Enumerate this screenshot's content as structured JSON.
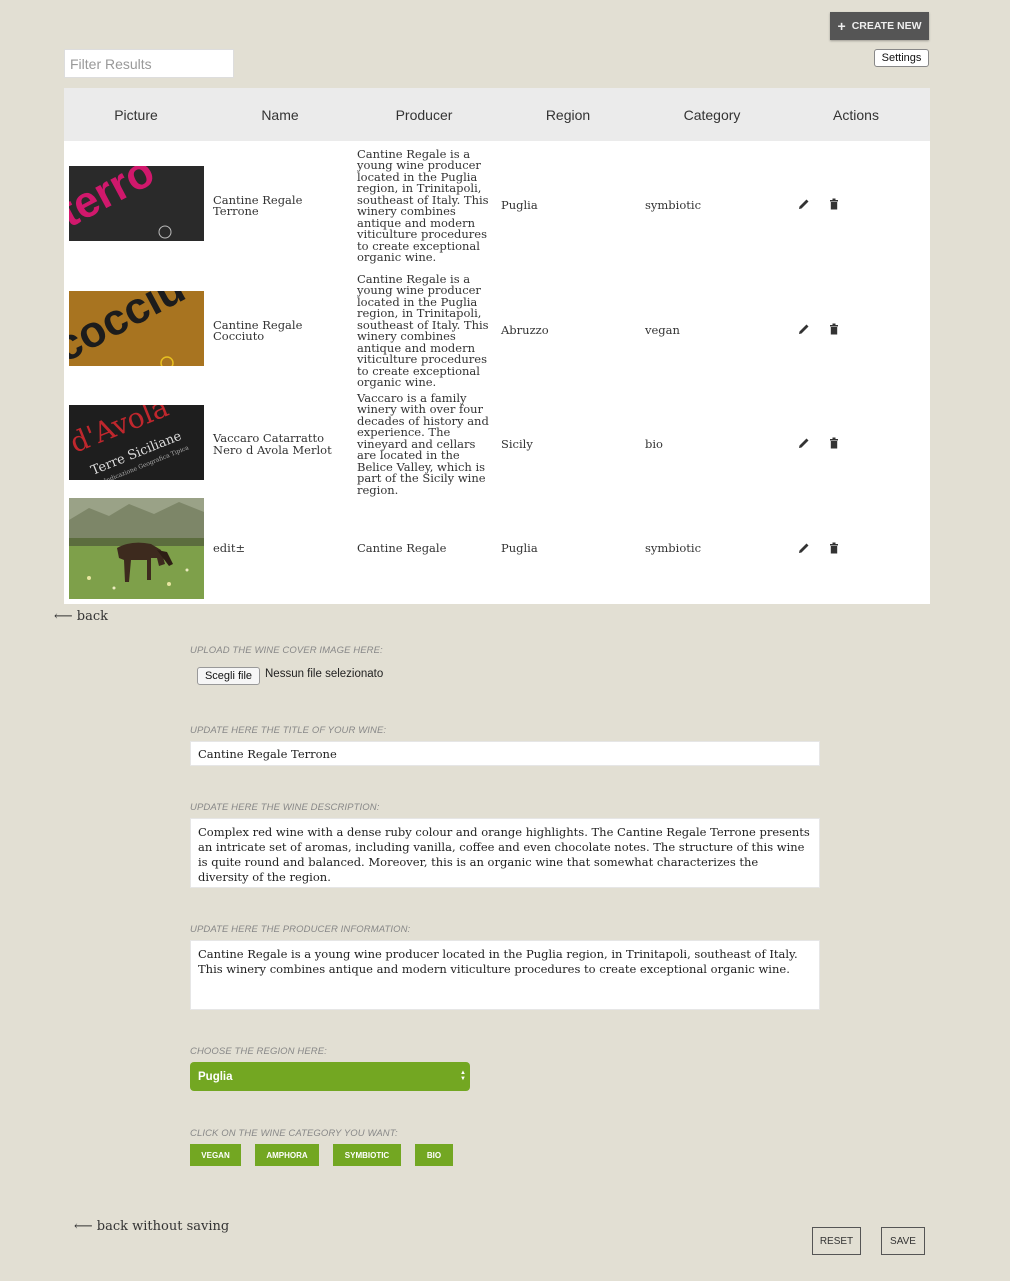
{
  "toolbar": {
    "create_label": "CREATE NEW",
    "filter_placeholder": "Filter Results",
    "settings_label": "Settings"
  },
  "table": {
    "columns": [
      "Picture",
      "Name",
      "Producer",
      "Region",
      "Category",
      "Actions"
    ],
    "rows": [
      {
        "name": "Cantine Regale Terrone",
        "producer": "Cantine Regale is a young wine producer located in the Puglia region, in Trinitapoli, southeast of Italy. This winery combines antique and modern viticulture procedures to create exceptional organic wine.",
        "region": "Puglia",
        "category": "symbiotic",
        "picture_text": "terro"
      },
      {
        "name": "Cantine Regale Cocciuto",
        "producer": "Cantine Regale is a young wine producer located in the Puglia region, in Trinitapoli, southeast of Italy. This winery combines antique and modern viticulture procedures to create exceptional organic wine.",
        "region": "Abruzzo",
        "category": "vegan",
        "picture_text": "cocciu"
      },
      {
        "name": "Vaccaro Catarratto Nero d Avola Merlot",
        "producer": "Vaccaro is a family winery with over four decades of history and experience. The vineyard and cellars are located in the Belice Valley, which is part of the Sicily wine region.",
        "region": "Sicily",
        "category": "bio",
        "picture_text": "d'Avola",
        "picture_text2": "Terre Siciliane",
        "picture_text3": "Indicazione Geografica Tipica"
      },
      {
        "name": "edit±",
        "producer": "Cantine Regale",
        "region": "Puglia",
        "category": "symbiotic"
      }
    ]
  },
  "back_label": "⟵ back",
  "form": {
    "upload_label": "UPLOAD THE WINE COVER IMAGE HERE:",
    "file_button": "Scegli file",
    "file_status": "Nessun file selezionato",
    "title_label": "UPDATE HERE THE TITLE OF YOUR WINE:",
    "title_value": "Cantine Regale Terrone",
    "description_label": "UPDATE HERE THE WINE DESCRIPTION:",
    "description_value": "Complex red wine with a dense ruby colour and orange highlights. The Cantine Regale Terrone presents an intricate set of aromas, including vanilla, coffee and even chocolate notes. The structure of this wine is quite round and balanced. Moreover, this is an organic wine that somewhat characterizes the diversity of the region.",
    "producer_label": "UPDATE HERE THE PRODUCER INFORMATION:",
    "producer_value": "Cantine Regale is a young wine producer located in the Puglia region, in Trinitapoli, southeast of Italy. This winery combines antique and modern viticulture procedures to create exceptional organic wine.",
    "region_label": "CHOOSE THE REGION HERE:",
    "region_value": "Puglia",
    "category_label": "CLICK ON THE WINE CATEGORY YOU WANT:",
    "categories": [
      "VEGAN",
      "AMPHORA",
      "SYMBIOTIC",
      "BIO"
    ]
  },
  "back_without_saving": "⟵ back without saving",
  "reset_label": "RESET",
  "save_label": "SAVE",
  "colors": {
    "accent": "#73a722",
    "background": "#e2dfd3",
    "dark_button": "#555555"
  }
}
